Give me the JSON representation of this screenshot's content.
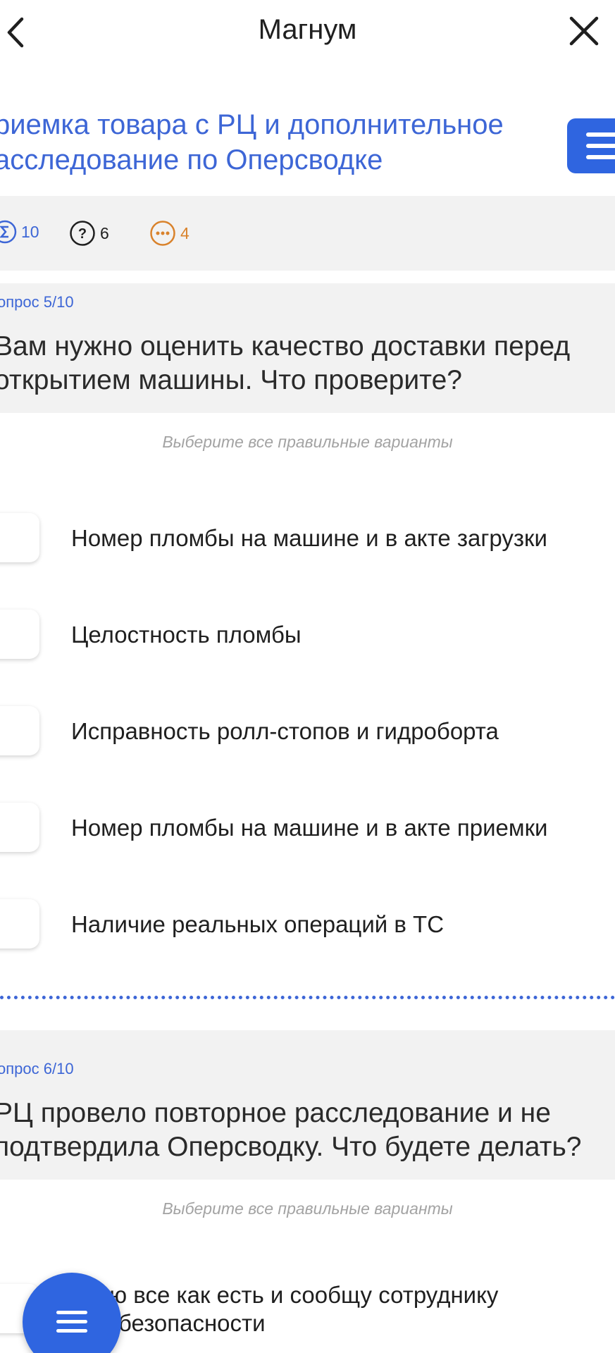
{
  "header": {
    "title": "Магнум",
    "back_icon": "chevron-left-icon",
    "close_icon": "close-icon"
  },
  "course": {
    "title": "риемка товара с РЦ и дополнительное асследование по Оперсводке",
    "title_line1": "риемка товара с РЦ и дополнительное",
    "title_line2": "асследование по Оперсводке",
    "menu_icon": "menu-icon"
  },
  "stats": {
    "total": "10",
    "unanswered": "6",
    "in_progress": "4"
  },
  "questions": [
    {
      "number_label": "опрос 5/10",
      "text_line1": "Вам нужно оценить качество доставки перед",
      "text_line2": "открытием машины. Что проверите?",
      "hint": "Выберите все правильные варианты",
      "options": [
        "Номер пломбы на машине и в акте загрузки",
        "Целостность пломбы",
        "Исправность ролл-стопов и гидроборта",
        "Номер пломбы на машине и в акте приемки",
        "Наличие реальных операций в ТС"
      ]
    },
    {
      "number_label": "опрос 6/10",
      "text_line1": "РЦ провело повторное расследование и не",
      "text_line2": "подтвердила Оперсводку. Что будете делать?",
      "hint": "Выберите все правильные варианты",
      "options_partial": [
        "авлю все как есть и сообщу сотруднику",
        "кбы безопасности"
      ]
    }
  ],
  "colors": {
    "accent": "#3d66d6",
    "button_blue": "#2f65e0",
    "orange": "#d9822b",
    "band_gray": "#f2f2f2",
    "hint_gray": "#a3a3a3"
  }
}
